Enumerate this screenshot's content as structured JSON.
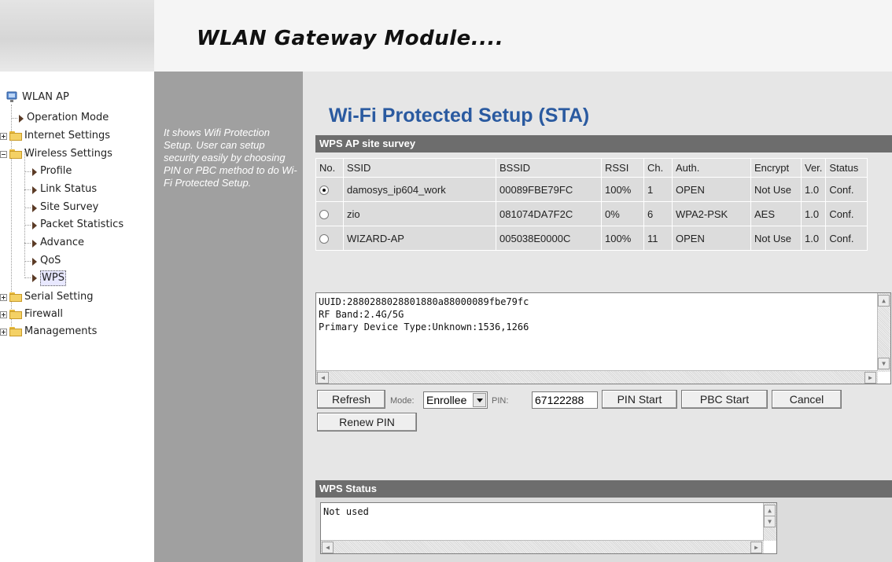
{
  "header": {
    "title": "WLAN Gateway Module...."
  },
  "tree": {
    "root": "WLAN AP",
    "items": [
      {
        "label": "Operation Mode"
      },
      {
        "label": "Internet Settings"
      },
      {
        "label": "Wireless Settings"
      },
      {
        "label": "Profile"
      },
      {
        "label": "Link Status"
      },
      {
        "label": "Site Survey"
      },
      {
        "label": "Packet Statistics"
      },
      {
        "label": "Advance"
      },
      {
        "label": "QoS"
      },
      {
        "label": "WPS"
      },
      {
        "label": "Serial Setting"
      },
      {
        "label": "Firewall"
      },
      {
        "label": "Managements"
      }
    ],
    "selected": "WPS"
  },
  "description": "It shows Wifi Protection Setup. User can setup security easily by choosing PIN or PBC method to do Wi-Fi Protected Setup.",
  "page_title": "Wi-Fi Protected Setup (STA)",
  "survey": {
    "section_title": "WPS AP site survey",
    "columns": [
      "No.",
      "SSID",
      "BSSID",
      "RSSI",
      "Ch.",
      "Auth.",
      "Encrypt",
      "Ver.",
      "Status"
    ],
    "rows": [
      {
        "selected": true,
        "ssid": "damosys_ip604_work",
        "bssid": "00089FBE79FC",
        "rssi": "100%",
        "ch": "1",
        "auth": "OPEN",
        "encrypt": "Not Use",
        "ver": "1.0",
        "status": "Conf."
      },
      {
        "selected": false,
        "ssid": "zio",
        "bssid": "081074DA7F2C",
        "rssi": "0%",
        "ch": "6",
        "auth": "WPA2-PSK",
        "encrypt": "AES",
        "ver": "1.0",
        "status": "Conf."
      },
      {
        "selected": false,
        "ssid": "WIZARD-AP",
        "bssid": "005038E0000C",
        "rssi": "100%",
        "ch": "11",
        "auth": "OPEN",
        "encrypt": "Not Use",
        "ver": "1.0",
        "status": "Conf."
      }
    ]
  },
  "info": {
    "lines": [
      "UUID:2880288028801880a88000089fbe79fc",
      "RF Band:2.4G/5G",
      "Primary Device Type:Unknown:1536,1266"
    ]
  },
  "controls": {
    "refresh": "Refresh",
    "mode_label": "Mode:",
    "mode_value": "Enrollee",
    "pin_label": "PIN:",
    "pin_value": "67122288",
    "pin_start": "PIN Start",
    "pbc_start": "PBC Start",
    "cancel": "Cancel",
    "renew_pin": "Renew PIN"
  },
  "status": {
    "section_title": "WPS Status",
    "text": "Not used"
  },
  "colors": {
    "title_blue": "#2a5aa0",
    "section_bar": "#6d6d6d",
    "desc_bg": "#a0a0a0"
  }
}
